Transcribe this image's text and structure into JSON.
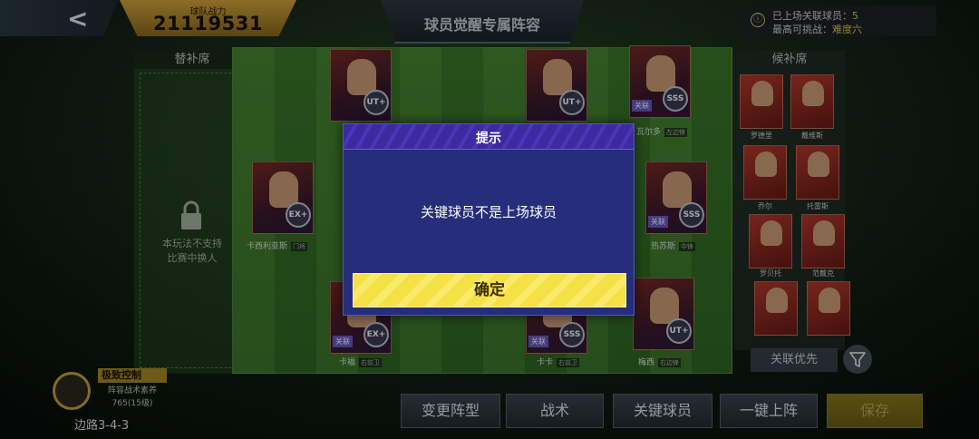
{
  "header": {
    "back_glyph": "<",
    "power_label": "球队战力",
    "power_value": "21119531",
    "title": "球员觉醒专属阵容",
    "info_icon": "ⓘ",
    "linked_players_label": "已上场关联球员：",
    "linked_players_value": "5",
    "max_challenge_label": "最高可挑战：",
    "max_challenge_value": "难度六"
  },
  "bench_left": {
    "title": "替补席",
    "note_line1": "本玩法不支持",
    "note_line2": "比赛中换人"
  },
  "bench_right": {
    "title": "候补席",
    "players": [
      {
        "name": "罗德里"
      },
      {
        "name": "戴维斯"
      },
      {
        "name": "乔尔"
      },
      {
        "name": "托雷斯"
      },
      {
        "name": "罗贝托"
      },
      {
        "name": "范戴克"
      },
      {
        "name": ""
      },
      {
        "name": ""
      }
    ],
    "link_priority": "关联优先"
  },
  "pitch": {
    "players": [
      {
        "name": "卡西利亚斯",
        "pos": "门将",
        "badge": "EX+",
        "tag": ""
      },
      {
        "name": "卡福",
        "pos": "右前卫",
        "badge": "EX+",
        "tag": "关联"
      },
      {
        "name": "卡卡",
        "pos": "右前卫",
        "badge": "SSS",
        "tag": "关联"
      },
      {
        "name": "梅西",
        "pos": "右边锋",
        "badge": "UT+",
        "tag": ""
      },
      {
        "name": "热苏斯",
        "pos": "中锋",
        "badge": "SSS",
        "tag": "关联"
      },
      {
        "name": "瓦尔多",
        "pos": "左边锋",
        "badge": "SSS",
        "tag": "关联"
      },
      {
        "name": "",
        "pos": "",
        "badge": "UT+",
        "tag": ""
      },
      {
        "name": "",
        "pos": "",
        "badge": "UT+",
        "tag": ""
      }
    ]
  },
  "control": {
    "title": "极致控制",
    "sub_line1": "阵容战术素养",
    "sub_line2": "765(15级)",
    "formation": "边路3-4-3"
  },
  "buttons": {
    "change_formation": "变更阵型",
    "tactics": "战术",
    "key_players": "关键球员",
    "one_click": "一键上阵",
    "save": "保存"
  },
  "dialog": {
    "title": "提示",
    "message": "关键球员不是上场球员",
    "confirm": "确定"
  },
  "colors": {
    "dialog_bg": "#262d7a",
    "confirm_yellow": "#f5e045",
    "gold": "#d4a73c"
  }
}
